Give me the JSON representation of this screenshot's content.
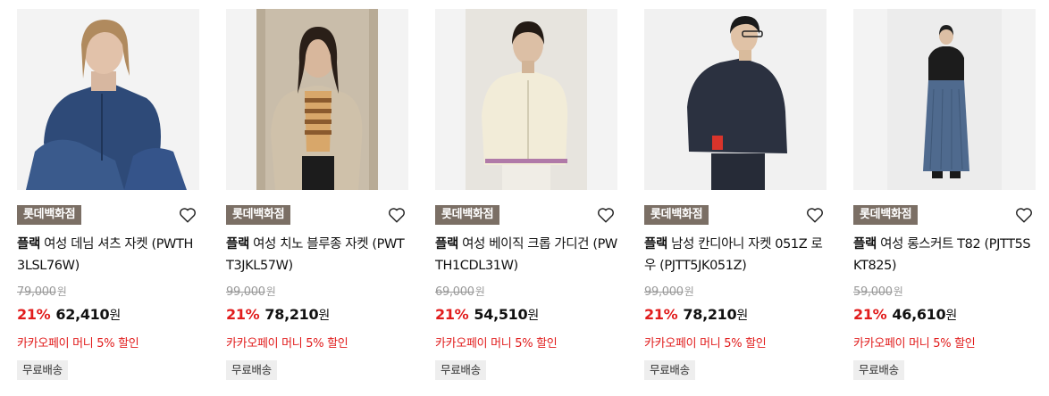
{
  "products": [
    {
      "store": "롯데백화점",
      "brand": "플랙",
      "name": " 여성 데님 셔츠 자켓 (PWTH3LSL76W)",
      "original_price": "79,000",
      "currency": "원",
      "discount": "21%",
      "sale_price": "62,410",
      "promo": "카카오페이 머니 5% 할인",
      "shipping": "무료배송"
    },
    {
      "store": "롯데백화점",
      "brand": "플랙",
      "name": " 여성 치노 블루종 자켓 (PWTT3JKL57W)",
      "original_price": "99,000",
      "currency": "원",
      "discount": "21%",
      "sale_price": "78,210",
      "promo": "카카오페이 머니 5% 할인",
      "shipping": "무료배송"
    },
    {
      "store": "롯데백화점",
      "brand": "플랙",
      "name": " 여성 베이직 크롭 가디건 (PWTH1CDL31W)",
      "original_price": "69,000",
      "currency": "원",
      "discount": "21%",
      "sale_price": "54,510",
      "promo": "카카오페이 머니 5% 할인",
      "shipping": "무료배송"
    },
    {
      "store": "롯데백화점",
      "brand": "플랙",
      "name": " 남성 칸디아니 자켓 051Z 로우 (PJTT5JK051Z)",
      "original_price": "99,000",
      "currency": "원",
      "discount": "21%",
      "sale_price": "78,210",
      "promo": "카카오페이 머니 5% 할인",
      "shipping": "무료배송"
    },
    {
      "store": "롯데백화점",
      "brand": "플랙",
      "name": " 여성 롱스커트 T82 (PJTT5SKT825)",
      "original_price": "59,000",
      "currency": "원",
      "discount": "21%",
      "sale_price": "46,610",
      "promo": "카카오페이 머니 5% 할인",
      "shipping": "무료배송"
    }
  ],
  "colors": {
    "store_badge": "#7b6f65",
    "discount": "#e11c1c",
    "promo": "#e11c1c"
  },
  "icons": {
    "wishlist": "heart-outline-icon"
  }
}
